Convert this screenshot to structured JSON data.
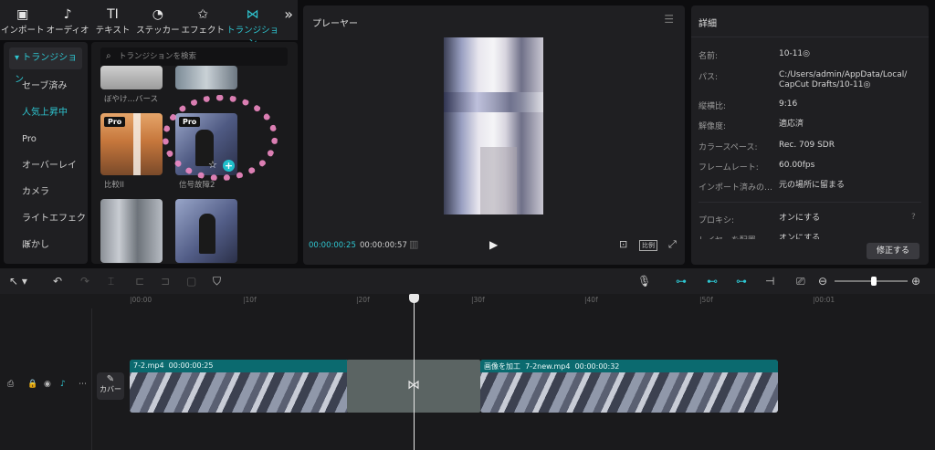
{
  "toolbar": {
    "items": [
      {
        "label": "インポート",
        "icon": "import-icon",
        "glyph": "▣"
      },
      {
        "label": "オーディオ",
        "icon": "audio-icon",
        "glyph": "♪"
      },
      {
        "label": "テキスト",
        "icon": "text-icon",
        "glyph": "TI"
      },
      {
        "label": "ステッカー",
        "icon": "sticker-icon",
        "glyph": "◔"
      },
      {
        "label": "エフェクト",
        "icon": "effect-icon",
        "glyph": "✩"
      },
      {
        "label": "トランジション",
        "icon": "transition-icon",
        "glyph": "⋈"
      }
    ],
    "more_glyph": "»",
    "active_color": "#2ec6d1"
  },
  "sidebar": {
    "items": [
      {
        "label": "▾ トランジション"
      },
      {
        "label": "セーブ済み"
      },
      {
        "label": "人気上昇中"
      },
      {
        "label": "Pro"
      },
      {
        "label": "オーバーレイ"
      },
      {
        "label": "カメラ"
      },
      {
        "label": "ライトエフェクト"
      },
      {
        "label": "ぼかし"
      }
    ]
  },
  "library": {
    "search_placeholder": "トランジションを検索",
    "items": [
      {
        "label": "ぼやけ…バース",
        "pro": ""
      },
      {
        "label": "",
        "pro": ""
      },
      {
        "label": "比較II",
        "pro": "Pro"
      },
      {
        "label": "信号故障2",
        "pro": "Pro"
      },
      {
        "label": "",
        "pro": ""
      },
      {
        "label": "",
        "pro": ""
      }
    ]
  },
  "player": {
    "title": "プレーヤー",
    "current_time": "00:00:00:25",
    "total_time": "00:00:00:57",
    "ratio_label": "比例"
  },
  "details": {
    "title": "詳細",
    "rows": [
      {
        "label": "名前:",
        "value": "10-11◎"
      },
      {
        "label": "パス:",
        "value": "C:/Users/admin/AppData/Local/ CapCut Drafts/10-11◎"
      },
      {
        "label": "縦横比:",
        "value": "9:16"
      },
      {
        "label": "解像度:",
        "value": "適応済"
      },
      {
        "label": "カラースペース:",
        "value": "Rec. 709 SDR"
      },
      {
        "label": "フレームレート:",
        "value": "60.00fps"
      },
      {
        "label": "インポート済みの…",
        "value": "元の場所に留まる"
      },
      {
        "label": "プロキシ:",
        "value": "オンにする"
      },
      {
        "label": "レイヤーを配置",
        "value": "オンにする"
      }
    ],
    "modify_button": "修正する"
  },
  "timeline": {
    "ruler_ticks": [
      "|00:00",
      "|10f",
      "|20f",
      "|30f",
      "|40f",
      "|50f",
      "|00:01"
    ],
    "cover_label": "カバー",
    "clip1": {
      "name": "7-2.mp4",
      "duration": "00:00:00:25"
    },
    "clip2": {
      "tag": "画像を加工",
      "name": "7-2new.mp4",
      "duration": "00:00:00:32"
    }
  }
}
